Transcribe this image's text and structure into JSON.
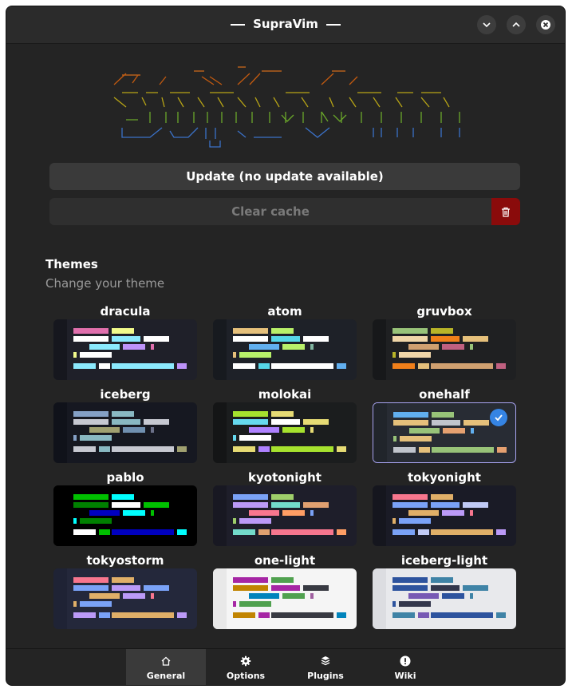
{
  "window": {
    "title": "SupraVim"
  },
  "actions": {
    "update_label": "Update (no update available)",
    "clear_cache_label": "Clear cache"
  },
  "themes_section": {
    "title": "Themes",
    "subtitle": "Change your theme",
    "selected": "onehalf",
    "items": [
      {
        "name": "dracula",
        "bg": "#1f2029",
        "gutter": "#16171e",
        "c": [
          "#e06fad",
          "#f1fa8c",
          "#ffffff",
          "#8be9fd",
          "#ffffff",
          "#8be9fd",
          "#bd93f9"
        ]
      },
      {
        "name": "atom",
        "bg": "#1e2128",
        "gutter": "#171a1f",
        "c": [
          "#e5c07b",
          "#b8f06a",
          "#ffffff",
          "#56d7e8",
          "#ffffff",
          "#61afef",
          "#b8f06a",
          "#80b4a0"
        ]
      },
      {
        "name": "gruvbox",
        "bg": "#1f2022",
        "gutter": "#17181a",
        "c": [
          "#98c379",
          "#b8b428",
          "#f0d6a8",
          "#f07f1a",
          "#e5c07b",
          "#d0a070",
          "#c06080"
        ]
      },
      {
        "name": "iceberg",
        "bg": "#161821",
        "gutter": "#10121a",
        "c": [
          "#84a0c6",
          "#89b8c2",
          "#c6c8d1",
          "#89b8c2",
          "#c6c8d1",
          "#a0a070",
          "#7090b0",
          "#6b7089"
        ]
      },
      {
        "name": "molokai",
        "bg": "#1b1d1e",
        "gutter": "#141516",
        "c": [
          "#a6e22e",
          "#e6db74",
          "#66d9ef",
          "#ffffff",
          "#e6db74",
          "#ae81ff"
        ]
      },
      {
        "name": "onehalf",
        "bg": "#282c34",
        "gutter": "#21252b",
        "c": [
          "#61afef",
          "#98c379",
          "#e5c07b",
          "#c0c4cc",
          "#e5c07b",
          "#98c379",
          "#e5a070"
        ]
      },
      {
        "name": "pablo",
        "bg": "#000000",
        "gutter": "#000000",
        "c": [
          "#00c000",
          "#00ffff",
          "#008000",
          "#ffffff",
          "#00c000",
          "#0000c0",
          "#00ffff"
        ]
      },
      {
        "name": "kyotonight",
        "bg": "#1e1e2a",
        "gutter": "#181822",
        "c": [
          "#7aa2f7",
          "#9ece6a",
          "#bb9af7",
          "#73daca",
          "#e0a070",
          "#f7768e",
          "#ff9e64"
        ]
      },
      {
        "name": "tokyonight",
        "bg": "#1a1b26",
        "gutter": "#15161e",
        "c": [
          "#f7768e",
          "#e0af68",
          "#7aa2f7",
          "#7aa2f7",
          "#c0caf5",
          "#e0af68",
          "#bb9af7"
        ]
      },
      {
        "name": "tokyostorm",
        "bg": "#24283b",
        "gutter": "#1f2335",
        "c": [
          "#f7768e",
          "#e0af68",
          "#7aa2f7",
          "#bb9af7",
          "#7aa2f7",
          "#e0af68",
          "#bb9af7"
        ]
      },
      {
        "name": "one-light",
        "bg": "#f5f5f5",
        "gutter": "#e8e8e8",
        "c": [
          "#a626a4",
          "#50a14f",
          "#c18401",
          "#a626a4",
          "#383a42",
          "#0184bc",
          "#50a14f",
          "#a060a0"
        ]
      },
      {
        "name": "iceberg-light",
        "bg": "#e8e9ec",
        "gutter": "#dcdde1",
        "c": [
          "#2d539e",
          "#3f83a6",
          "#2d539e",
          "#33374c",
          "#3f83a6",
          "#7759b4"
        ]
      }
    ]
  },
  "bottom_nav": {
    "tabs": [
      {
        "label": "General",
        "icon": "home-icon",
        "active": true
      },
      {
        "label": "Options",
        "icon": "gear-icon",
        "active": false
      },
      {
        "label": "Plugins",
        "icon": "plugin-icon",
        "active": false
      },
      {
        "label": "Wiki",
        "icon": "info-icon",
        "active": false
      }
    ]
  }
}
